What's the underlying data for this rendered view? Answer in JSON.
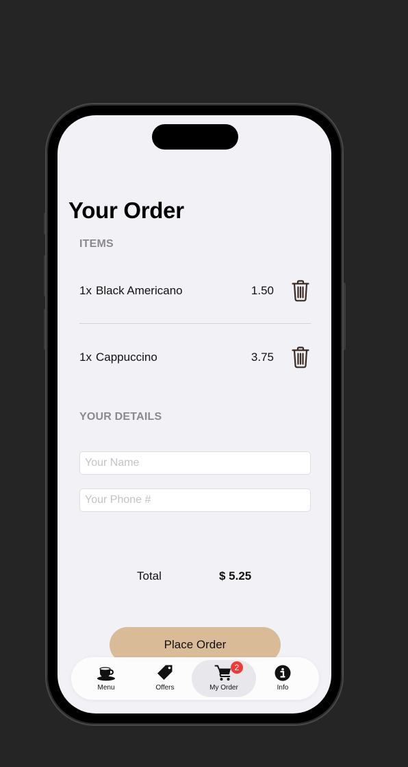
{
  "header": {
    "title": "Your Order"
  },
  "sections": {
    "items_title": "ITEMS",
    "details_title": "YOUR DETAILS"
  },
  "items": [
    {
      "qty": "1x",
      "name": "Black Americano",
      "price": "1.50",
      "delete_icon": "trash-icon"
    },
    {
      "qty": "1x",
      "name": "Cappuccino",
      "price": "3.75",
      "delete_icon": "trash-icon"
    }
  ],
  "details": {
    "name_placeholder": "Your Name",
    "name_value": "",
    "phone_placeholder": "Your Phone #",
    "phone_value": ""
  },
  "summary": {
    "total_label": "Total",
    "total_value": "$ 5.25"
  },
  "actions": {
    "place_order_label": "Place Order"
  },
  "tabs": [
    {
      "label": "Menu",
      "icon": "coffee-cup-icon",
      "active": false
    },
    {
      "label": "Offers",
      "icon": "tag-icon",
      "active": false
    },
    {
      "label": "My Order",
      "icon": "cart-icon",
      "active": true,
      "badge": "2"
    },
    {
      "label": "Info",
      "icon": "info-icon",
      "active": false
    }
  ],
  "colors": {
    "accent_button": "#d9bb98",
    "badge": "#ef3b36",
    "screen_background": "#f2f1f6",
    "outer_background": "#252525"
  }
}
